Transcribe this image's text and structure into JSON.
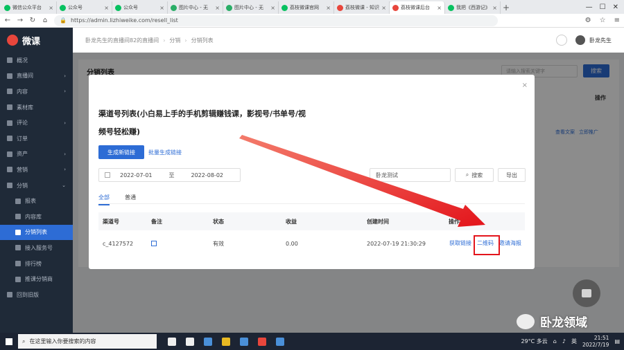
{
  "browser": {
    "tabs": [
      {
        "title": "微信公众平台",
        "color": "#07c160"
      },
      {
        "title": "公众号",
        "color": "#07c160"
      },
      {
        "title": "公众号",
        "color": "#07c160"
      },
      {
        "title": "图片中心 - 无",
        "color": "#2aae67"
      },
      {
        "title": "图片中心 - 无",
        "color": "#2aae67"
      },
      {
        "title": "荔枝微课官网",
        "color": "#07c160"
      },
      {
        "title": "荔枝微课 - 知识",
        "color": "#e8463c"
      },
      {
        "title": "荔枝微课后台",
        "color": "#e8463c",
        "active": true
      },
      {
        "title": "我把《西游记》",
        "color": "#07c160"
      }
    ],
    "url": "https://admin.lizhiweike.com/resell_list"
  },
  "sidebar": {
    "logo": "微课",
    "items": [
      {
        "label": "概况"
      },
      {
        "label": "直播间",
        "arrow": "›"
      },
      {
        "label": "内容",
        "arrow": "›"
      },
      {
        "label": "素材库"
      },
      {
        "label": "评论",
        "arrow": "›"
      },
      {
        "label": "订单"
      },
      {
        "label": "资产",
        "arrow": "›"
      },
      {
        "label": "营销",
        "arrow": "›"
      },
      {
        "label": "分销",
        "arrow": "⌄"
      },
      {
        "label": "报表",
        "sub": true
      },
      {
        "label": "内容库",
        "sub": true
      },
      {
        "label": "分销列表",
        "sub": true,
        "active": true
      },
      {
        "label": "接入服务号",
        "sub": true
      },
      {
        "label": "排行榜",
        "sub": true
      },
      {
        "label": "推课分销商",
        "sub": true
      },
      {
        "label": "回到旧版"
      }
    ]
  },
  "header": {
    "breadcrumb": [
      "卧龙先生的直播间82的直播间",
      "分销",
      "分销列表"
    ],
    "user": "卧龙先生"
  },
  "page": {
    "title": "分销列表",
    "search_placeholder": "请输入搜索关键字",
    "search_button": "搜索",
    "col_operation": "操作",
    "links": [
      "查看文案",
      "立即推广"
    ]
  },
  "modal": {
    "close": "×",
    "title": "渠道号列表(小白易上手的手机剪辑赚钱课，影视号/书单号/视频号轻松赚)",
    "create_button": "生成新链接",
    "batch_link": "批量生成链接",
    "date_start": "2022-07-01",
    "date_to": "至",
    "date_end": "2022-08-02",
    "keyword_value": "卧龙测试",
    "search_button": "搜索",
    "export_button": "导出",
    "tabs": [
      "全部",
      "普通"
    ],
    "columns": [
      "渠道号",
      "备注",
      "状态",
      "收益",
      "创建时间",
      "操作"
    ],
    "rows": [
      {
        "channel": "c_4127572",
        "status": "有效",
        "income": "0.00",
        "created": "2022-07-19 21:30:29",
        "ops": [
          "获取链接",
          "二维码",
          "邀请海报"
        ]
      }
    ]
  },
  "watermark": "卧龙领域",
  "taskbar": {
    "search_placeholder": "在这里输入你要搜索的内容",
    "weather": "29°C 多云",
    "ime": "英",
    "time": "21:51",
    "date": "2022/7/19"
  },
  "colors": {
    "accent": "#2d6cd5",
    "highlight": "#e3141b",
    "sidebar": "#1f2a38"
  }
}
